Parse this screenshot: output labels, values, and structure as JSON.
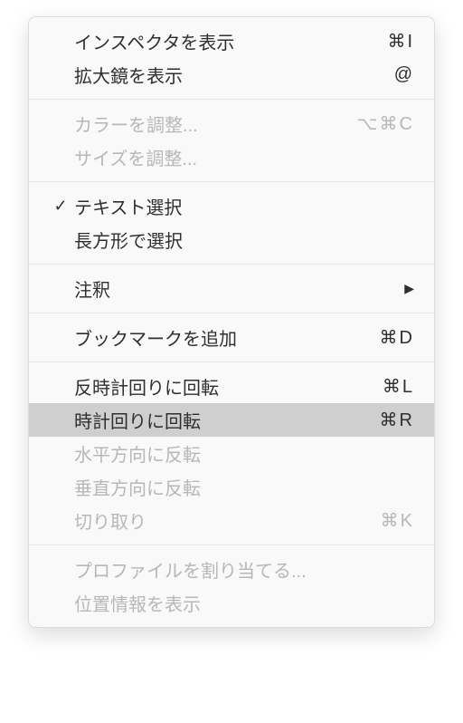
{
  "menu": {
    "items": [
      {
        "label": "インスペクタを表示",
        "shortcut": "⌘I",
        "checked": false,
        "disabled": false,
        "highlight": false,
        "submenu": false
      },
      {
        "label": "拡大鏡を表示",
        "shortcut": "@",
        "checked": false,
        "disabled": false,
        "highlight": false,
        "submenu": false
      },
      {
        "separator": true
      },
      {
        "label": "カラーを調整...",
        "shortcut": "⌥⌘C",
        "checked": false,
        "disabled": true,
        "highlight": false,
        "submenu": false
      },
      {
        "label": "サイズを調整...",
        "shortcut": "",
        "checked": false,
        "disabled": true,
        "highlight": false,
        "submenu": false
      },
      {
        "separator": true
      },
      {
        "label": "テキスト選択",
        "shortcut": "",
        "checked": true,
        "disabled": false,
        "highlight": false,
        "submenu": false
      },
      {
        "label": "長方形で選択",
        "shortcut": "",
        "checked": false,
        "disabled": false,
        "highlight": false,
        "submenu": false
      },
      {
        "separator": true
      },
      {
        "label": "注釈",
        "shortcut": "",
        "checked": false,
        "disabled": false,
        "highlight": false,
        "submenu": true
      },
      {
        "separator": true
      },
      {
        "label": "ブックマークを追加",
        "shortcut": "⌘D",
        "checked": false,
        "disabled": false,
        "highlight": false,
        "submenu": false
      },
      {
        "separator": true
      },
      {
        "label": "反時計回りに回転",
        "shortcut": "⌘L",
        "checked": false,
        "disabled": false,
        "highlight": false,
        "submenu": false
      },
      {
        "label": "時計回りに回転",
        "shortcut": "⌘R",
        "checked": false,
        "disabled": false,
        "highlight": true,
        "submenu": false
      },
      {
        "label": "水平方向に反転",
        "shortcut": "",
        "checked": false,
        "disabled": true,
        "highlight": false,
        "submenu": false
      },
      {
        "label": "垂直方向に反転",
        "shortcut": "",
        "checked": false,
        "disabled": true,
        "highlight": false,
        "submenu": false
      },
      {
        "label": "切り取り",
        "shortcut": "⌘K",
        "checked": false,
        "disabled": true,
        "highlight": false,
        "submenu": false
      },
      {
        "separator": true
      },
      {
        "label": "プロファイルを割り当てる...",
        "shortcut": "",
        "checked": false,
        "disabled": true,
        "highlight": false,
        "submenu": false
      },
      {
        "label": "位置情報を表示",
        "shortcut": "",
        "checked": false,
        "disabled": true,
        "highlight": false,
        "submenu": false
      }
    ],
    "check_char": "✓",
    "arrow_char": "▶"
  }
}
